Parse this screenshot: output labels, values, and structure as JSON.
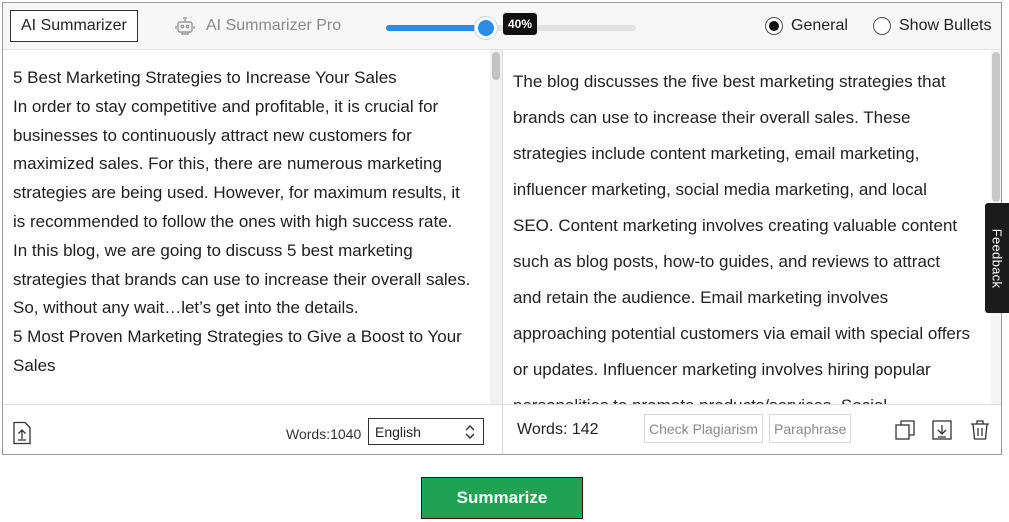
{
  "topbar": {
    "mode_basic_label": "AI Summarizer",
    "mode_pro_label": "AI Summarizer Pro",
    "slider": {
      "value_percent": 40,
      "label": "40%"
    },
    "radio_general_label": "General",
    "radio_bullets_label": "Show Bullets",
    "selected_mode": "General"
  },
  "input": {
    "paragraphs": [
      "5 Best Marketing Strategies to Increase Your Sales",
      "In order to stay competitive and profitable, it is crucial for businesses to continuously attract new customers for maximized sales. For this, there are numerous marketing strategies are being used. However, for maximum results, it is recommended to follow the ones with high success rate.",
      "In this blog, we are going to discuss 5 best marketing strategies that brands can use to increase their overall sales. So, without any wait…let’s get into the details.",
      "5 Most Proven Marketing Strategies to Give a Boost to Your Sales"
    ],
    "word_count_label": "Words:1040",
    "language": "English"
  },
  "output": {
    "text": "The blog discusses the five best marketing strategies that brands can use to increase their overall sales. These strategies include content marketing, email marketing, influencer marketing, social media marketing, and local SEO. Content marketing involves creating valuable content such as blog posts, how-to guides, and reviews to attract and retain the audience. Email marketing involves approaching potential customers via email with special offers or updates. Influencer marketing involves hiring popular personalities to promote products/services. Social",
    "word_count_label": "Words: 142",
    "check_plagiarism_label": "Check Plagiarism",
    "paraphrase_label": "Paraphrase"
  },
  "feedback_label": "Feedback",
  "summarize_label": "Summarize",
  "icons": {
    "pro": "robot-icon",
    "upload": "upload-icon",
    "language_arrows": "chevron-up-down-icon",
    "copy": "copy-icon",
    "download": "download-icon",
    "delete": "trash-icon"
  },
  "colors": {
    "accent": "#2a8ce6",
    "summarize": "#1fa353"
  }
}
